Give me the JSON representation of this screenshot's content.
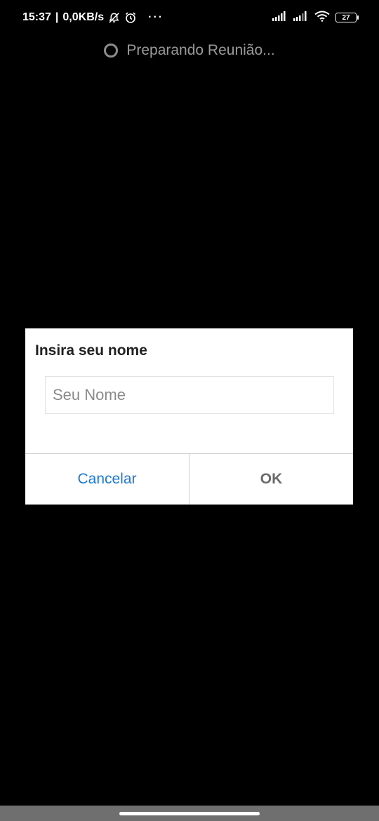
{
  "status_bar": {
    "time": "15:37",
    "separator": "|",
    "net_speed": "0,0KB/s",
    "dots": "···",
    "battery_level": "27",
    "icons": [
      "bell-off-icon",
      "alarm-icon",
      "signal-icon",
      "signal-icon",
      "wifi-icon",
      "battery-icon"
    ]
  },
  "loading": {
    "text": "Preparando Reunião..."
  },
  "dialog": {
    "title": "Insira seu nome",
    "input_placeholder": "Seu Nome",
    "input_value": "",
    "cancel_label": "Cancelar",
    "ok_label": "OK"
  },
  "colors": {
    "background": "#000000",
    "dialog_bg": "#ffffff",
    "cancel_accent": "#1f78d1",
    "ok_text": "#6b6b6b",
    "loading_text": "#9a9a9a"
  }
}
